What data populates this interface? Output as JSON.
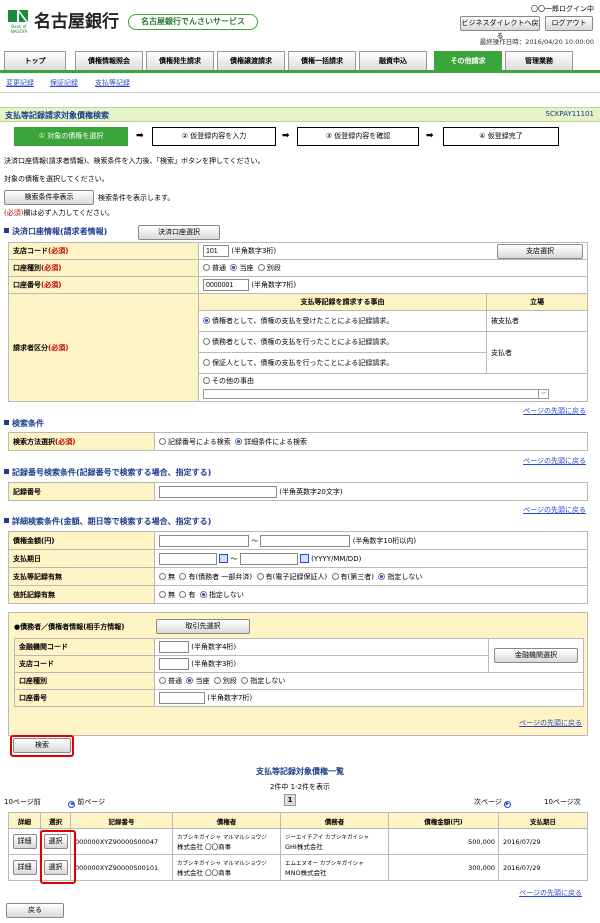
{
  "header": {
    "bank_name": "名古屋銀行",
    "logo_sub": "Bank of NAGOYA",
    "service_badge": "名古屋銀行でんさいサービス",
    "user_login": "〇〇一郎ログイン中",
    "btn_business_direct": "ビジネスダイレクトへ戻る",
    "btn_logout": "ログアウト",
    "last_operation": "最終操作日時：2016/04/20 10:00:00"
  },
  "tabs": [
    "トップ",
    "債権情報照会",
    "債権発生請求",
    "債権譲渡請求",
    "債権一括請求",
    "融資申込",
    "その他請求",
    "管理業務"
  ],
  "subnav": [
    "変更記録",
    "保証記録",
    "支払等記録"
  ],
  "page": {
    "title": "支払等記録請求対象債権検索",
    "screen_id": "SCKPAY11101"
  },
  "steps": [
    "① 対象の債権を選択",
    "② 仮登録内容を入力",
    "③ 仮登録内容を確認",
    "④ 仮登録完了"
  ],
  "arrow": "➡",
  "instructions": {
    "line1": "決済口座情報(請求者情報)、検索条件を入力後、「検索」ボタンを押してください。",
    "line2": "対象の債権を選択してください。",
    "toggle_btn": "検索条件非表示",
    "toggle_note": "検索条件を表示します。",
    "req_mark": "(必須)",
    "req_note": "欄は必ず入力してください。"
  },
  "account": {
    "section_title": "決済口座情報(請求者情報)",
    "select_btn": "決済口座選択",
    "branch_label": "支店コード",
    "branch_value": "101",
    "branch_hint": "(半角数字3桁)",
    "branch_btn": "支店選択",
    "type_label": "口座種別",
    "type_options": [
      "普通",
      "当座",
      "別段"
    ],
    "num_label": "口座番号",
    "num_value": "0000001",
    "num_hint": "(半角数字7桁)",
    "req_label": "請求者区分",
    "reason_header": "支払等記録を請求する事由",
    "position_header": "立場",
    "reasons": [
      "債権者として、債権の支払を受けたことによる記録請求。",
      "債務者として、債権の支払を行ったことによる記録請求。",
      "保証人として、債権の支払を行ったことによる記録請求。",
      "その他の事由"
    ],
    "pos_creditor": "被支払者",
    "pos_debtor": "支払者"
  },
  "back_to_top": "ページの先頭に戻る",
  "search": {
    "section_title": "検索条件",
    "method_label": "検索方法選択",
    "method_options": [
      "記録番号による検索",
      "詳細条件による検索"
    ]
  },
  "record": {
    "section_title": "記録番号検索条件(記録番号で検索する場合、指定する)",
    "label": "記録番号",
    "hint": "(半角英数字20文字)"
  },
  "detail": {
    "section_title": "詳細検索条件(金額、期日等で検索する場合、指定する)",
    "amount_label": "債権金額(円)",
    "tilde": "～",
    "amount_hint": "(半角数字10桁以内)",
    "date_label": "支払期日",
    "date_hint": "(YYYY/MM/DD)",
    "pay_label": "支払等記録有無",
    "pay_options": [
      "無",
      "有(債務者 一部弁済)",
      "有(電子記録保証人)",
      "有(第三者)",
      "指定しない"
    ],
    "trust_label": "信託記録有無",
    "trust_options": [
      "無",
      "有",
      "指定しない"
    ],
    "party_title": "●債務者／債権者情報(相手方情報)",
    "partner_btn": "取引先選択",
    "fin_label": "金融機関コード",
    "fin_hint": "(半角数字4桁)",
    "fin_btn": "金融機関選択",
    "branch_label": "支店コード",
    "branch_hint": "(半角数字3桁)",
    "type_label": "口座種別",
    "type_options": [
      "普通",
      "当座",
      "別段",
      "指定しない"
    ],
    "num_label": "口座番号",
    "num_hint": "(半角数字7桁)"
  },
  "search_btn": "検索",
  "results": {
    "title": "支払等記録対象債権一覧",
    "count": "2件中 1-2件を表示",
    "prev10": "10ページ前",
    "prev": "前ページ",
    "page": "1",
    "next": "次ページ",
    "next10": "10ページ次",
    "headers": [
      "詳細",
      "選択",
      "記録番号",
      "債権者",
      "債務者",
      "債権金額(円)",
      "支払期日"
    ],
    "detail_btn": "詳細",
    "select_btn": "選択",
    "rows": [
      {
        "record": "000000XYZ90000S00047",
        "creditor_kana": "カブシキガイシャ マルマルショウジ",
        "creditor": "株式会社 〇〇商事",
        "debtor_kana": "ジーエイチアイ カブシキガイシャ",
        "debtor": "GHI株式会社",
        "amount": "500,000",
        "date": "2016/07/29"
      },
      {
        "record": "000000XYZ90000S00101",
        "creditor_kana": "カブシキガイシャ マルマルショウジ",
        "creditor": "株式会社 〇〇商事",
        "debtor_kana": "エムエヌオー カブシキガイシャ",
        "debtor": "MNO株式会社",
        "amount": "300,000",
        "date": "2016/07/29"
      }
    ]
  },
  "back_btn": "戻る",
  "colors": {
    "accent_green": "#3aa53a",
    "label_bg": "#fdf3c4",
    "title_bg": "#e6f3c8",
    "nav_link": "#2a48c8",
    "highlight": "#e00000"
  }
}
